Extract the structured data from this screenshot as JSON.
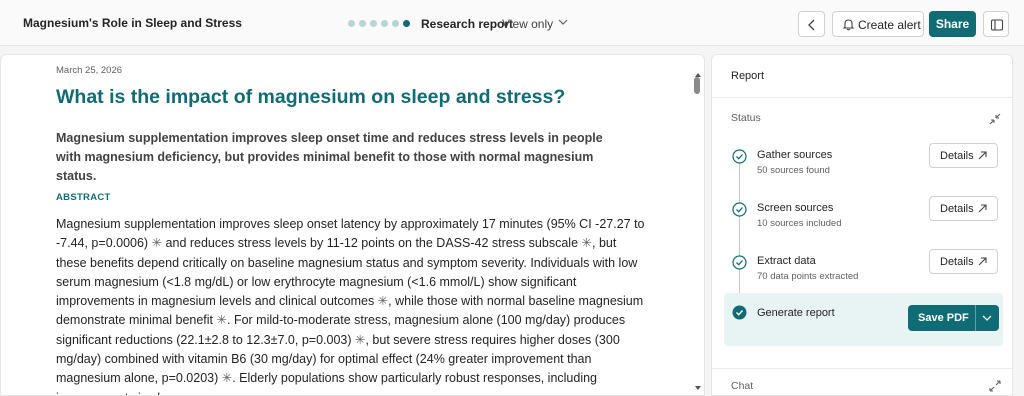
{
  "header": {
    "title": "Magnesium's Role in Sleep and Stress",
    "progress": {
      "total_steps": 6,
      "current_step": 6
    },
    "report_label": "Research report",
    "mode_label": "View only",
    "create_alert_label": "Create alert",
    "share_label": "Share"
  },
  "document": {
    "date": "March 25, 2026",
    "title": "What is the impact of magnesium on sleep and stress?",
    "summary": "Magnesium supplementation improves sleep onset time and reduces stress levels in people with magnesium deficiency, but provides minimal benefit to those with normal magnesium status.",
    "abstract_label": "ABSTRACT",
    "abstract": {
      "p1": "Magnesium supplementation improves sleep onset latency by approximately 17 minutes (95% CI -27.27 to -7.44, p=0.0006)",
      "p2": " and reduces stress levels by 11-12 points on the DASS-42 stress subscale",
      "p3": ", but these benefits depend critically on baseline magnesium status and symptom severity. Individuals with low serum magnesium (<1.8 mg/dL) or low erythrocyte magnesium (<1.6 mmol/L) show significant improvements in magnesium levels and clinical outcomes",
      "p4": ", while those with normal baseline magnesium demonstrate minimal benefit",
      "p5": ". For mild-to-moderate stress, magnesium alone (100 mg/day) produces significant reductions (22.1±2.8 to 12.3±7.0, p=0.003)",
      "p6": ", but severe stress requires higher doses (300 mg/day) combined with vitamin B6 (30 mg/day) for optimal effect (24% greater improvement than magnesium alone, p=0.0203)",
      "p7": ". Elderly populations show particularly robust responses, including improvements in slow-wave",
      "cite_marker": "✳"
    }
  },
  "report_panel": {
    "title": "Report",
    "status_label": "Status",
    "steps": [
      {
        "name": "Gather sources",
        "detail": "50 sources found",
        "action": "Details"
      },
      {
        "name": "Screen sources",
        "detail": "10 sources included",
        "action": "Details"
      },
      {
        "name": "Extract data",
        "detail": "70 data points extracted",
        "action": "Details"
      }
    ],
    "generate": {
      "name": "Generate report",
      "action": "Save PDF"
    },
    "chat_label": "Chat"
  },
  "colors": {
    "accent": "#0f6c75",
    "accent_light": "#e8f4f4",
    "dot_inactive": "#b8d4d6"
  }
}
